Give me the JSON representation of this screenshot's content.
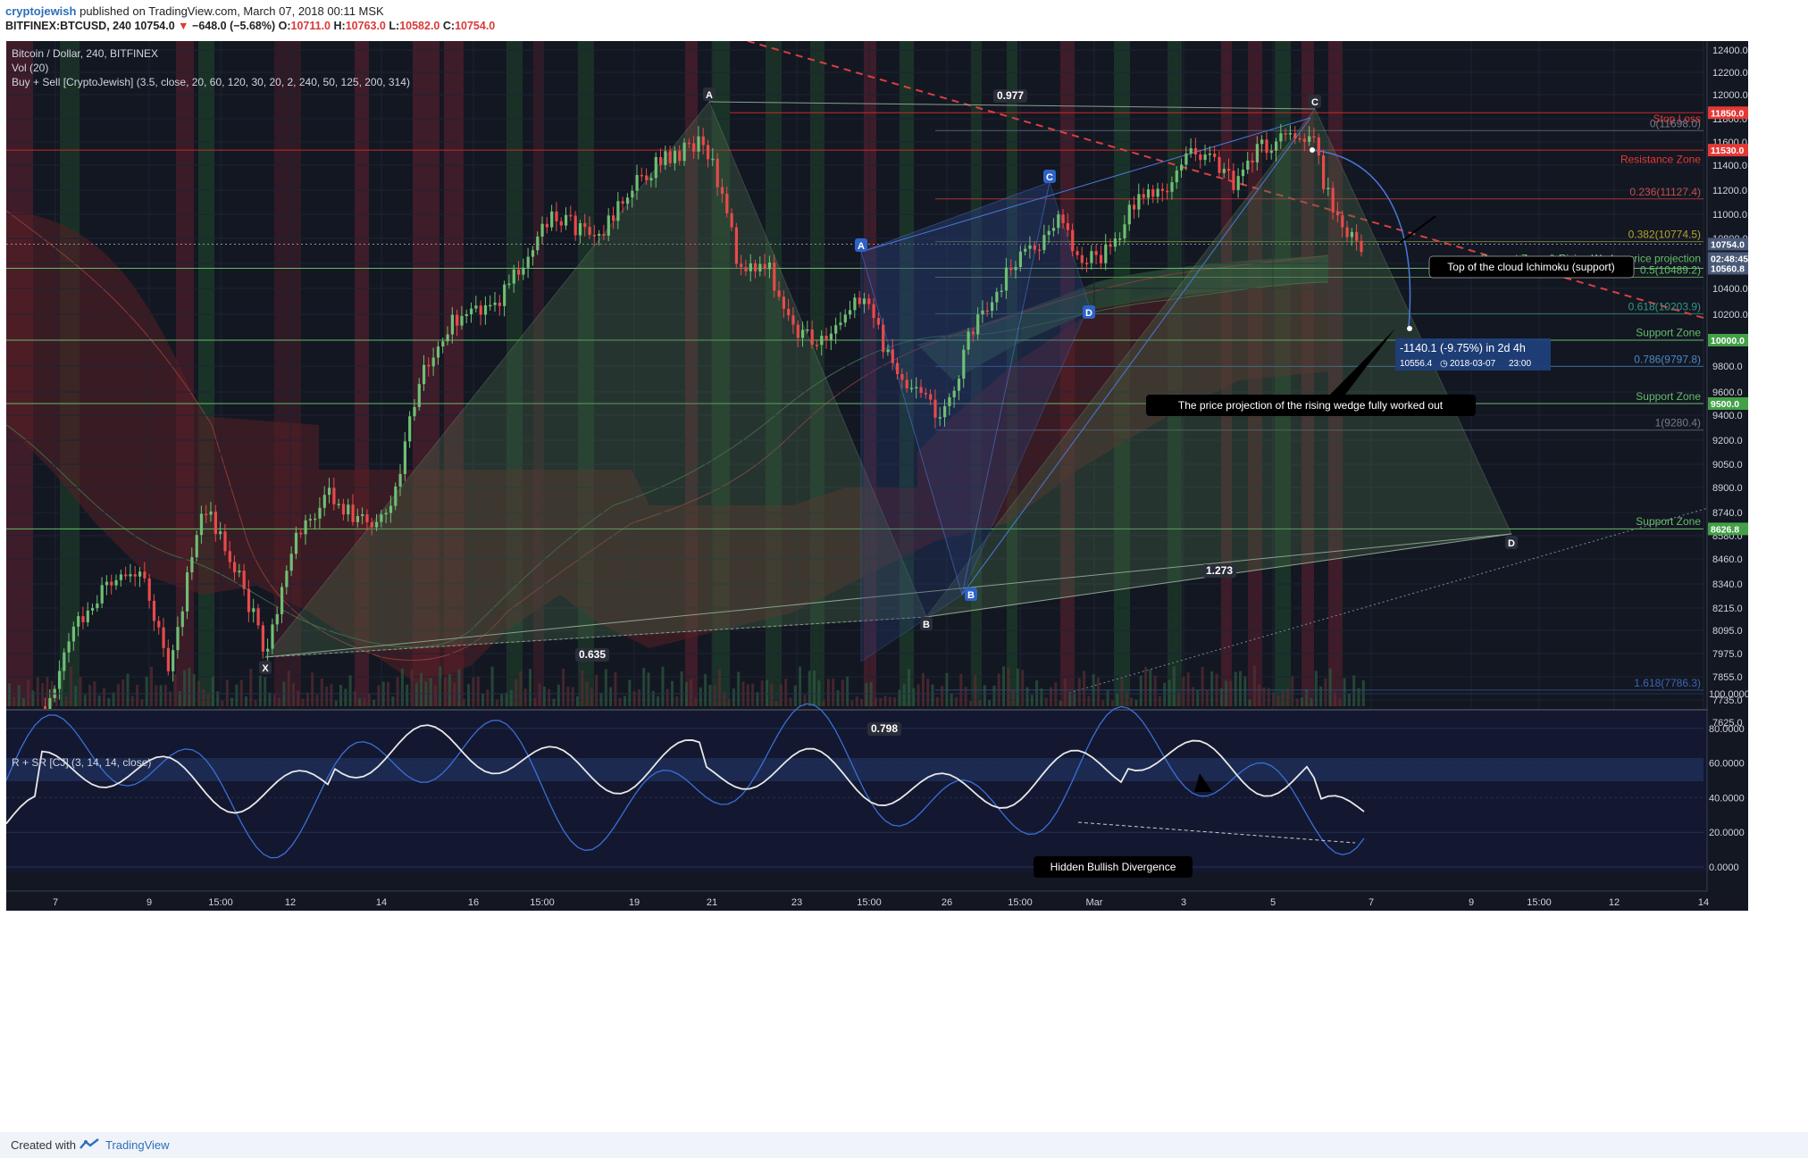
{
  "header": {
    "author": "cryptojewish",
    "published_text": "published on TradingView.com, March 07, 2018 00:11 MSK",
    "symbol_line": "BITFINEX:BTCUSD, 240",
    "last_price": "10754.0",
    "change": "−648.0 (−5.68%)",
    "o_label": "O:",
    "o_val": "10711.0",
    "h_label": "H:",
    "h_val": "10763.0",
    "l_label": "L:",
    "l_val": "10582.0",
    "c_label": "C:",
    "c_val": "10754.0"
  },
  "legend": {
    "title": "Bitcoin / Dollar, 240, BITFINEX",
    "volume": "Vol (20)",
    "indicator": "Buy + Sell [CryptoJewish] (3.5, close, 20, 60, 120, 30, 20, 2, 240, 50, 125, 200, 314)",
    "oscillator": "R + SR [CJ] (3, 14, 14, close)"
  },
  "price_axis": [
    "12400.0",
    "12200.0",
    "12000.0",
    "11800.0",
    "11600.0",
    "11400.0",
    "11200.0",
    "11000.0",
    "10800.0",
    "10600.0",
    "10400.0",
    "10200.0",
    "10000.0",
    "9800.0",
    "9600.0",
    "9400.0",
    "9200.0",
    "9050.0",
    "8900.0",
    "8740.0",
    "8580.0",
    "8460.0",
    "8340.0",
    "8215.0",
    "8095.0",
    "7975.0",
    "7855.0",
    "7735.0",
    "7625.0"
  ],
  "osc_axis": [
    "100.0000",
    "80.0000",
    "60.0000",
    "40.0000",
    "20.0000",
    "0.0000"
  ],
  "time_axis": [
    "7",
    "9",
    "15:00",
    "12",
    "14",
    "16",
    "15:00",
    "19",
    "21",
    "23",
    "15:00",
    "26",
    "15:00",
    "Mar",
    "3",
    "5",
    "7",
    "9",
    "15:00",
    "12",
    "14"
  ],
  "price_tags": [
    {
      "text": "11850.0",
      "color": "#e53935"
    },
    {
      "text": "11530.0",
      "color": "#e53935"
    },
    {
      "text": "10754.0",
      "color": "#4a5a78"
    },
    {
      "text": "02:48:45",
      "color": "#4a5a78"
    },
    {
      "text": "10560.8",
      "color": "#4a5a78"
    },
    {
      "text": "10000.0",
      "color": "#43a047"
    },
    {
      "text": "9500.0",
      "color": "#43a047"
    },
    {
      "text": "8626.8",
      "color": "#43a047"
    }
  ],
  "level_labels": {
    "stop_loss": "Stop Loss",
    "resistance": "Resistance Zone",
    "support_wedge": "Support Zone & Rising Wedge price projection",
    "support1": "Support Zone",
    "support2": "Support Zone",
    "support3": "Support Zone"
  },
  "fib_labels": [
    "0(11698.0)",
    "0.236(11127.4)",
    "0.382(10774.5)",
    "0.5(10489.2)",
    "0.618(10203.9)",
    "0.786(9797.8)",
    "1(9280.4)",
    "1.618(7786.3)"
  ],
  "pattern_points": {
    "X": "X",
    "A": "A",
    "B": "B",
    "C": "C",
    "D": "D"
  },
  "pattern_ratios": [
    "0.977",
    "0.635",
    "0.798",
    "1.273"
  ],
  "annotations": {
    "ichimoku": "Top of the cloud Ichimoku (support)",
    "wedge": "The price projection of the rising wedge fully worked out",
    "divergence": "Hidden Bullish Divergence",
    "measure_main": "-1140.1 (-9.75%) in 2d 4h",
    "measure_price": "10556.4",
    "measure_date": "2018-03-07",
    "measure_time": "23:00"
  },
  "footer": {
    "created_with": "Created with",
    "brand": "TradingView"
  },
  "colors": {
    "background": "#131722",
    "up": "#6fbf73",
    "down": "#e84a4a",
    "osc_line": "#e8e8e8",
    "osc_blue": "#3b6fd6",
    "fib": "#e57373",
    "support": "#66bb6a"
  }
}
